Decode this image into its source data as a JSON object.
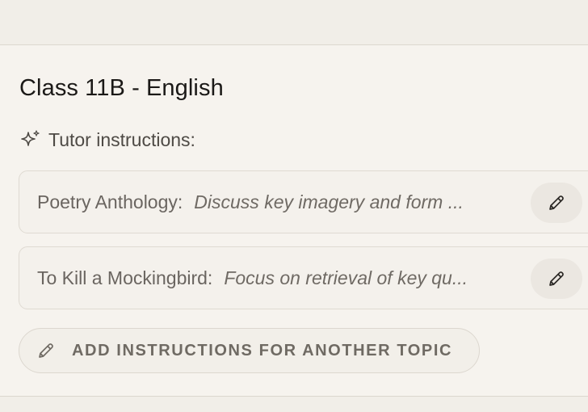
{
  "class": {
    "title": "Class 11B - English"
  },
  "tutor": {
    "label": "Tutor instructions:",
    "icon": "sparkle-icon"
  },
  "topics": [
    {
      "name": "Poetry Anthology:",
      "description": "Discuss key imagery and form ...",
      "edit_icon": "pencil-icon"
    },
    {
      "name": "To Kill a Mockingbird:",
      "description": "Focus on retrieval of key qu...",
      "edit_icon": "pencil-icon"
    }
  ],
  "add_topic": {
    "label": "ADD INSTRUCTIONS FOR ANOTHER TOPIC",
    "icon": "pencil-icon"
  },
  "colors": {
    "background": "#f6f3ee",
    "card_background": "#f4f1ec",
    "card_border": "#dfdad2",
    "edit_button_background": "#ebe7e1",
    "title_text": "#1b1917",
    "muted_text": "#6f6a64"
  }
}
